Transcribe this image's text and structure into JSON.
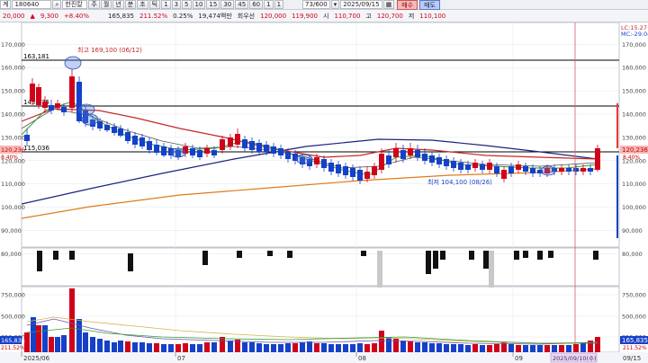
{
  "toolbar": {
    "account_label": "계",
    "stock_code": "180640",
    "stock_name": "한진칼",
    "periods": [
      "주",
      "월",
      "년",
      "분",
      "초",
      "틱"
    ],
    "intervals": [
      "1",
      "3",
      "5",
      "10",
      "15",
      "30",
      "45",
      "60"
    ],
    "extra_buttons": [
      "1",
      "1"
    ],
    "page_counter": "73/600",
    "date": "2025/09/15",
    "buy_label": "매수",
    "sell_label": "매도",
    "volume": "165,835",
    "volume_ratio": "211.52%",
    "turnover_rate": "0.25%",
    "trade_value": "19,474백만",
    "prev_days_label": "회우선",
    "open_label": "시",
    "high_label": "고",
    "low_label": "저",
    "high_price": "120,700",
    "low_price": "110,100",
    "ask_prices": [
      "120,000",
      "119,900"
    ],
    "open_price": "110,700",
    "price": "20,000",
    "change_arrow": "▲",
    "change": "9,300",
    "change_pct": "+8.40%"
  },
  "chart": {
    "price_axis_ticks": [
      "170,000",
      "160,000",
      "150,000",
      "140,000",
      "130,000",
      "120,000",
      "110,000",
      "100,000",
      "90,000",
      "80,000"
    ],
    "left_axis_ticks": [
      "170,000",
      "160,000",
      "150,000",
      "140,000",
      "130,000",
      "120,000",
      "110,000",
      "100,000",
      "90,000",
      "80,000"
    ],
    "volume_axis_ticks": [
      "750,000",
      "500,000",
      "250,000"
    ],
    "left_volume_ticks": [
      "750,000",
      "500,000",
      "250,000"
    ],
    "date_labels": [
      "2025/06",
      "07",
      "08",
      "09"
    ],
    "right_date": "09/15",
    "cursor_date": "2025/09/10(수)",
    "hline_labels": [
      "163,181",
      "143,475",
      "115,036"
    ],
    "high_annotation": "최고 169,100 (06/12)",
    "low_annotation": "최저 104,100 (08/26)",
    "right_price_badge": "120,236",
    "right_price_pct": "8.40%",
    "left_price_badge": "120,236",
    "left_price_pct": "8.40%",
    "right_volume_badge": "165,835",
    "right_volume_pct": "211.52%",
    "left_volume_badge": "165,835",
    "left_volume_pct": "211.52%",
    "legend_lc": "LC:15.27",
    "legend_mc": "MC:-29.04",
    "colors": {
      "up": "#d0021b",
      "down": "#1541c8",
      "ma5": "#33a02c",
      "ma20": "#c62828",
      "ma60": "#1a237e",
      "ma120": "#e07b1a",
      "vol_ma": "#d4b44a"
    }
  }
}
